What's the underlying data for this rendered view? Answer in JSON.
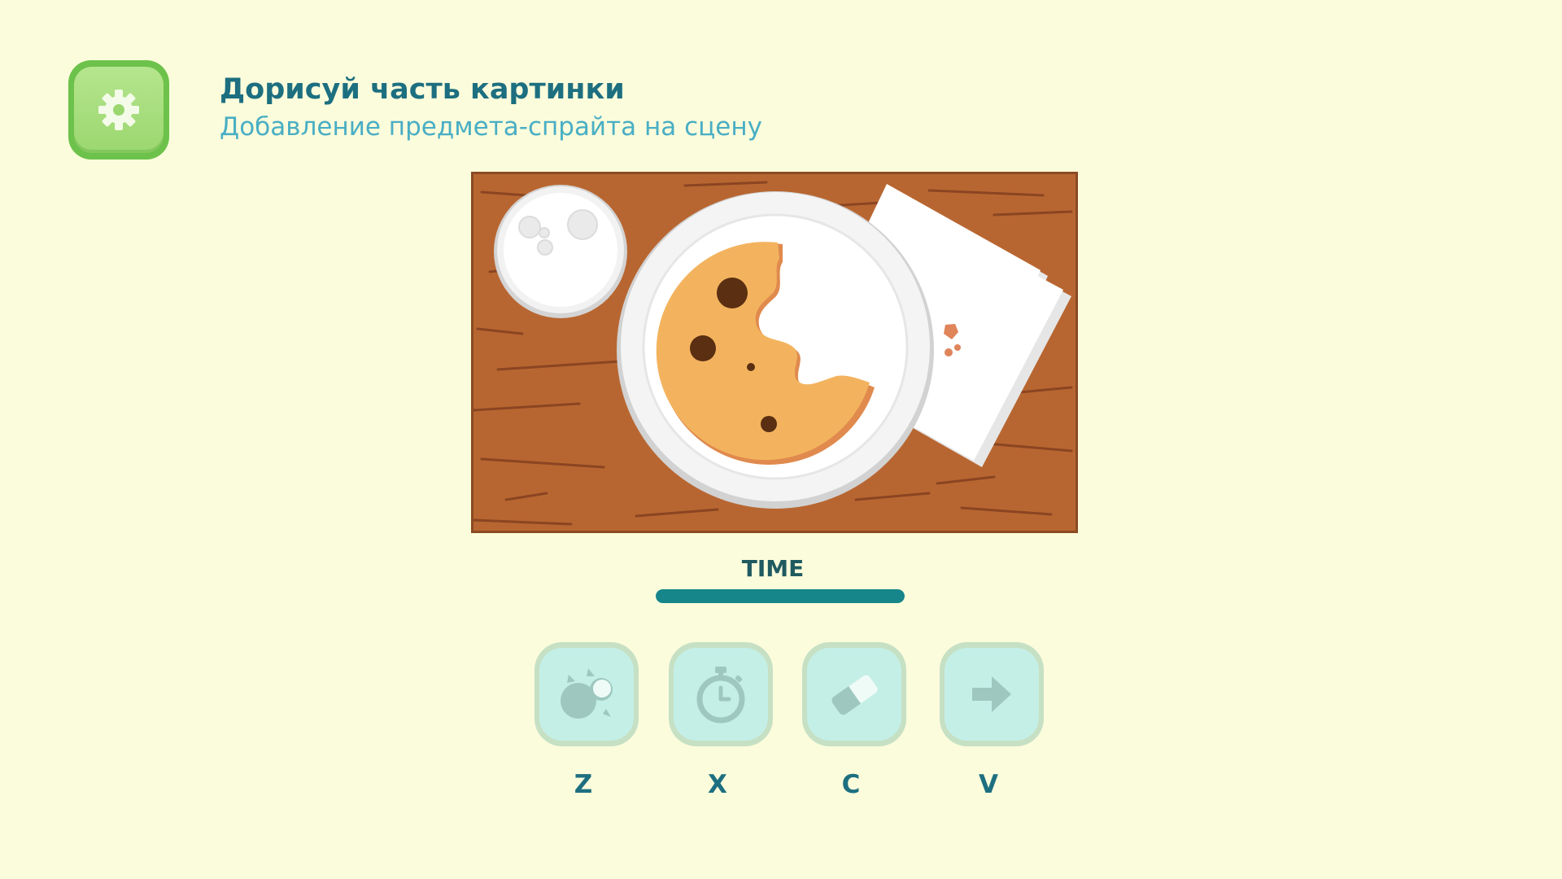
{
  "header": {
    "title": "Дорисуй часть картинки",
    "subtitle": "Добавление предмета-спрайта на сцену"
  },
  "settings": {
    "icon": "gear-icon"
  },
  "timer": {
    "label": "TIME",
    "progress": 1.0
  },
  "tools": [
    {
      "icon": "sprite-burst-icon",
      "key": "Z"
    },
    {
      "icon": "stopwatch-icon",
      "key": "X"
    },
    {
      "icon": "eraser-icon",
      "key": "C"
    },
    {
      "icon": "arrow-right-icon",
      "key": "V"
    }
  ],
  "colors": {
    "background": "#fbfcdc",
    "title": "#1d6f80",
    "subtitle": "#49aec4",
    "timer_fill": "#16868a",
    "button_face": "#c4efe7",
    "table_wood": "#b86631"
  }
}
